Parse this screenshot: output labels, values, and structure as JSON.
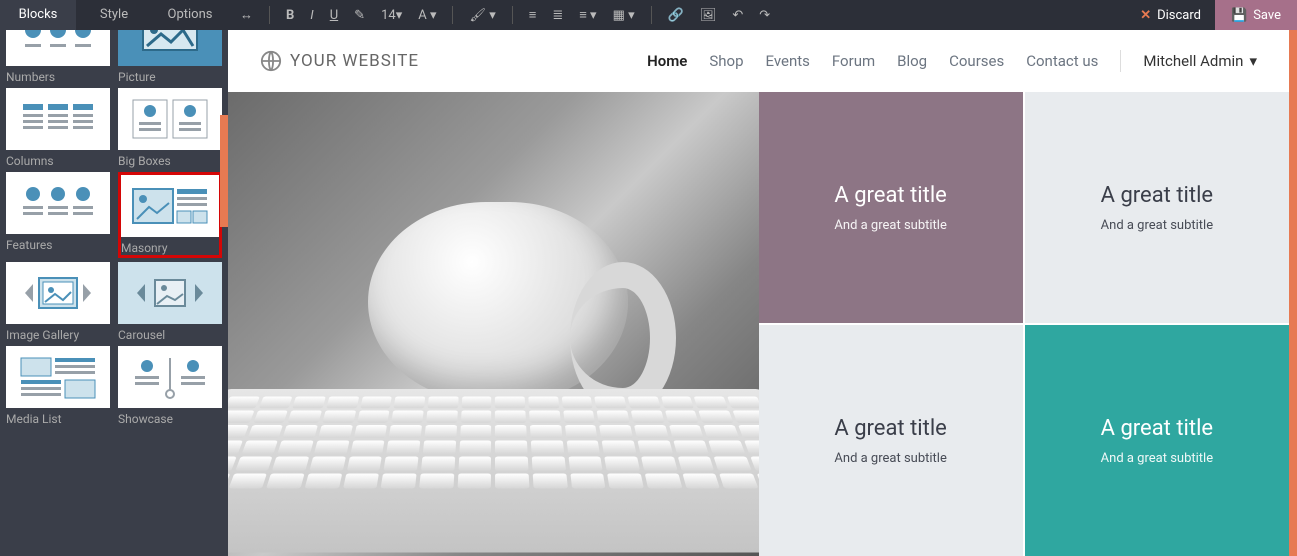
{
  "tabs": {
    "blocks": "Blocks",
    "style": "Style",
    "options": "Options"
  },
  "toolbar": {
    "fontsize": "14",
    "discard": "Discard",
    "save": "Save"
  },
  "blocks": [
    {
      "label": "Numbers"
    },
    {
      "label": "Picture"
    },
    {
      "label": "Columns"
    },
    {
      "label": "Big Boxes"
    },
    {
      "label": "Features"
    },
    {
      "label": "Masonry"
    },
    {
      "label": "Image Gallery"
    },
    {
      "label": "Carousel"
    },
    {
      "label": "Media List"
    },
    {
      "label": "Showcase"
    }
  ],
  "site": {
    "brand": "YOUR WEBSITE",
    "user": "Mitchell Admin"
  },
  "nav": [
    "Home",
    "Shop",
    "Events",
    "Forum",
    "Blog",
    "Courses",
    "Contact us"
  ],
  "tiles": [
    {
      "title": "A great title",
      "sub": "And a great subtitle",
      "color": "purple"
    },
    {
      "title": "A great title",
      "sub": "And a great subtitle",
      "color": "gray"
    },
    {
      "title": "A great title",
      "sub": "And a great subtitle",
      "color": "gray"
    },
    {
      "title": "A great title",
      "sub": "And a great subtitle",
      "color": "teal"
    }
  ]
}
